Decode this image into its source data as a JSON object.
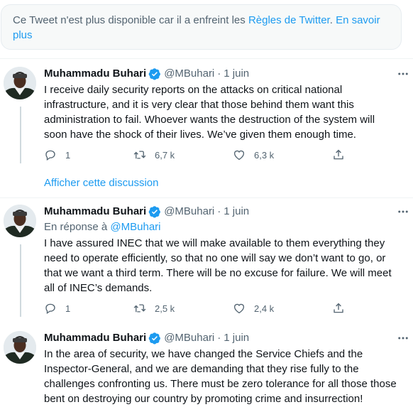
{
  "notice": {
    "text": "Ce Tweet n'est plus disponible car il a enfreint les ",
    "rules_link": "Règles de Twitter",
    "separator": ". ",
    "learn_more": "En savoir plus"
  },
  "show_thread_label": "Afficher cette discussion",
  "tweets": [
    {
      "name": "Muhammadu Buhari",
      "handle": "@MBuhari",
      "dot": "·",
      "date": "1 juin",
      "reply_prefix": "",
      "reply_handle": "",
      "text": "I receive daily security reports on the attacks on critical national infrastructure, and it is very clear that those behind them want this administration to fail. Whoever wants the destruction of the system will soon have the shock of their lives. We’ve given them enough time.",
      "replies": "1",
      "retweets": "6,7 k",
      "likes": "6,3 k"
    },
    {
      "name": "Muhammadu Buhari",
      "handle": "@MBuhari",
      "dot": "·",
      "date": "1 juin",
      "reply_prefix": "En réponse à ",
      "reply_handle": "@MBuhari",
      "text": "I have assured INEC that we will make available to them everything they need to operate efficiently, so that no one will say we don’t want to go, or that we want a third term. There will be no excuse for failure. We will meet all of INEC’s demands.",
      "replies": "1",
      "retweets": "2,5 k",
      "likes": "2,4 k"
    },
    {
      "name": "Muhammadu Buhari",
      "handle": "@MBuhari",
      "dot": "·",
      "date": "1 juin",
      "text": "In the area of security, we have changed the Service Chiefs and the Inspector-General, and we are demanding that they rise fully to the challenges confronting us. There must be zero tolerance for all those those bent on destroying our country by promoting crime and insurrection!"
    }
  ],
  "colors": {
    "accent": "#1d9bf0",
    "secondary_text": "#536471",
    "primary_text": "#0f1419"
  },
  "icons": [
    "verified-badge-icon",
    "more-options-icon",
    "reply-icon",
    "retweet-icon",
    "like-icon",
    "share-icon"
  ]
}
